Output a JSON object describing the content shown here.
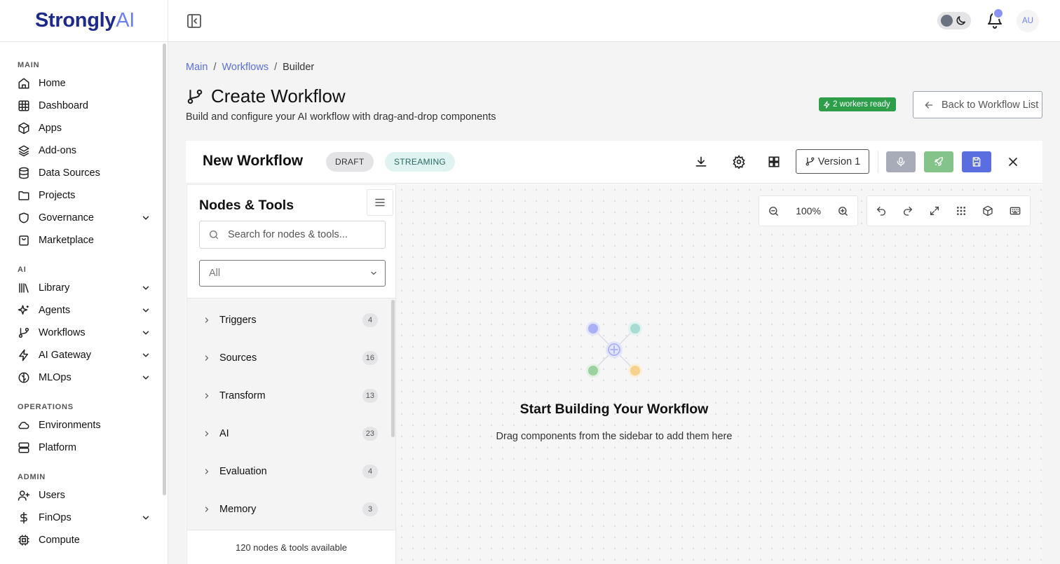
{
  "brand": {
    "name_main": "Strongly",
    "name_suffix": "AI"
  },
  "sidebar": {
    "sections": [
      {
        "title": "MAIN",
        "items": [
          {
            "label": "Home",
            "icon": "home-icon"
          },
          {
            "label": "Dashboard",
            "icon": "grid-icon"
          },
          {
            "label": "Apps",
            "icon": "box-icon"
          },
          {
            "label": "Add-ons",
            "icon": "layers-icon"
          },
          {
            "label": "Data Sources",
            "icon": "database-icon"
          },
          {
            "label": "Projects",
            "icon": "folder-icon"
          },
          {
            "label": "Governance",
            "icon": "shield-icon",
            "expandable": true
          },
          {
            "label": "Marketplace",
            "icon": "shopping-bag-icon"
          }
        ]
      },
      {
        "title": "AI",
        "items": [
          {
            "label": "Library",
            "icon": "library-icon",
            "expandable": true
          },
          {
            "label": "Agents",
            "icon": "sparkles-icon",
            "expandable": true
          },
          {
            "label": "Workflows",
            "icon": "git-branch-icon",
            "expandable": true
          },
          {
            "label": "AI Gateway",
            "icon": "zap-icon",
            "expandable": true
          },
          {
            "label": "MLOps",
            "icon": "brain-icon",
            "expandable": true
          }
        ]
      },
      {
        "title": "OPERATIONS",
        "items": [
          {
            "label": "Environments",
            "icon": "cloud-icon"
          },
          {
            "label": "Platform",
            "icon": "server-icon"
          }
        ]
      },
      {
        "title": "ADMIN",
        "items": [
          {
            "label": "Users",
            "icon": "user-plus-icon"
          },
          {
            "label": "FinOps",
            "icon": "dollar-icon",
            "expandable": true
          },
          {
            "label": "Compute",
            "icon": "cpu-icon"
          }
        ]
      }
    ]
  },
  "topbar": {
    "avatar_initials": "AU"
  },
  "breadcrumb": {
    "items": [
      "Main",
      "Workflows",
      "Builder"
    ],
    "separator": "/"
  },
  "page": {
    "title": "Create Workflow",
    "subtitle": "Build and configure your AI workflow with drag-and-drop components",
    "workers_badge": "2 workers ready",
    "back_button": "Back to Workflow List"
  },
  "builder": {
    "workflow_name": "New Workflow",
    "tags": [
      "DRAFT",
      "STREAMING"
    ],
    "version_label": "Version 1"
  },
  "nodes_panel": {
    "title": "Nodes & Tools",
    "search_placeholder": "Search for nodes & tools...",
    "filter_value": "All",
    "categories": [
      {
        "label": "Triggers",
        "count": "4"
      },
      {
        "label": "Sources",
        "count": "16"
      },
      {
        "label": "Transform",
        "count": "13"
      },
      {
        "label": "AI",
        "count": "23"
      },
      {
        "label": "Evaluation",
        "count": "4"
      },
      {
        "label": "Memory",
        "count": "3"
      }
    ],
    "footer": "120 nodes & tools available"
  },
  "canvas": {
    "zoom": "100%",
    "empty_title": "Start Building Your Workflow",
    "empty_subtitle": "Drag components from the sidebar to add them here"
  },
  "colors": {
    "accent": "#5b6ee0",
    "brand_dark": "#1e2a8a",
    "success": "#2e9e4a",
    "deploy": "#84c48b"
  }
}
